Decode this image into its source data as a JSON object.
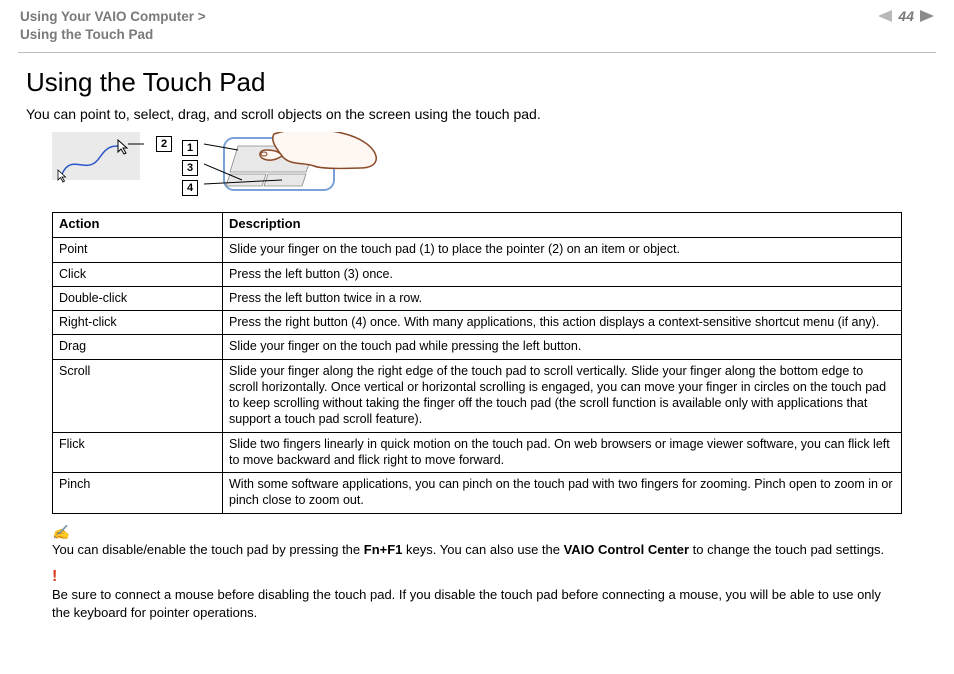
{
  "header": {
    "breadcrumb_line1": "Using Your VAIO Computer >",
    "breadcrumb_line2": "Using the Touch Pad",
    "page_number": "44"
  },
  "title": "Using the Touch Pad",
  "intro": "You can point to, select, drag, and scroll objects on the screen using the touch pad.",
  "callouts": {
    "c1": "1",
    "c2": "2",
    "c3": "3",
    "c4": "4"
  },
  "table": {
    "header_action": "Action",
    "header_description": "Description",
    "rows": [
      {
        "action": "Point",
        "desc": "Slide your finger on the touch pad (1) to place the pointer (2) on an item or object."
      },
      {
        "action": "Click",
        "desc": "Press the left button (3) once."
      },
      {
        "action": "Double-click",
        "desc": "Press the left button twice in a row."
      },
      {
        "action": "Right-click",
        "desc": "Press the right button (4) once. With many applications, this action displays a context-sensitive shortcut menu (if any)."
      },
      {
        "action": "Drag",
        "desc": "Slide your finger on the touch pad while pressing the left button."
      },
      {
        "action": "Scroll",
        "desc": "Slide your finger along the right edge of the touch pad to scroll vertically. Slide your finger along the bottom edge to scroll horizontally. Once vertical or horizontal scrolling is engaged, you can move your finger in circles on the touch pad to keep scrolling without taking the finger off the touch pad (the scroll function is available only with applications that support a touch pad scroll feature)."
      },
      {
        "action": "Flick",
        "desc": "Slide two fingers linearly in quick motion on the touch pad. On web browsers or image viewer software, you can flick left to move backward and flick right to move forward."
      },
      {
        "action": "Pinch",
        "desc": "With some software applications, you can pinch on the touch pad with two fingers for zooming. Pinch open to zoom in or pinch close to zoom out."
      }
    ]
  },
  "note": {
    "prefix": "You can disable/enable the touch pad by pressing the ",
    "keys": "Fn+F1",
    "middle": " keys. You can also use the ",
    "center": "VAIO Control Center",
    "suffix": " to change the touch pad settings."
  },
  "warning": "Be sure to connect a mouse before disabling the touch pad. If you disable the touch pad before connecting a mouse, you will be able to use only the keyboard for pointer operations."
}
